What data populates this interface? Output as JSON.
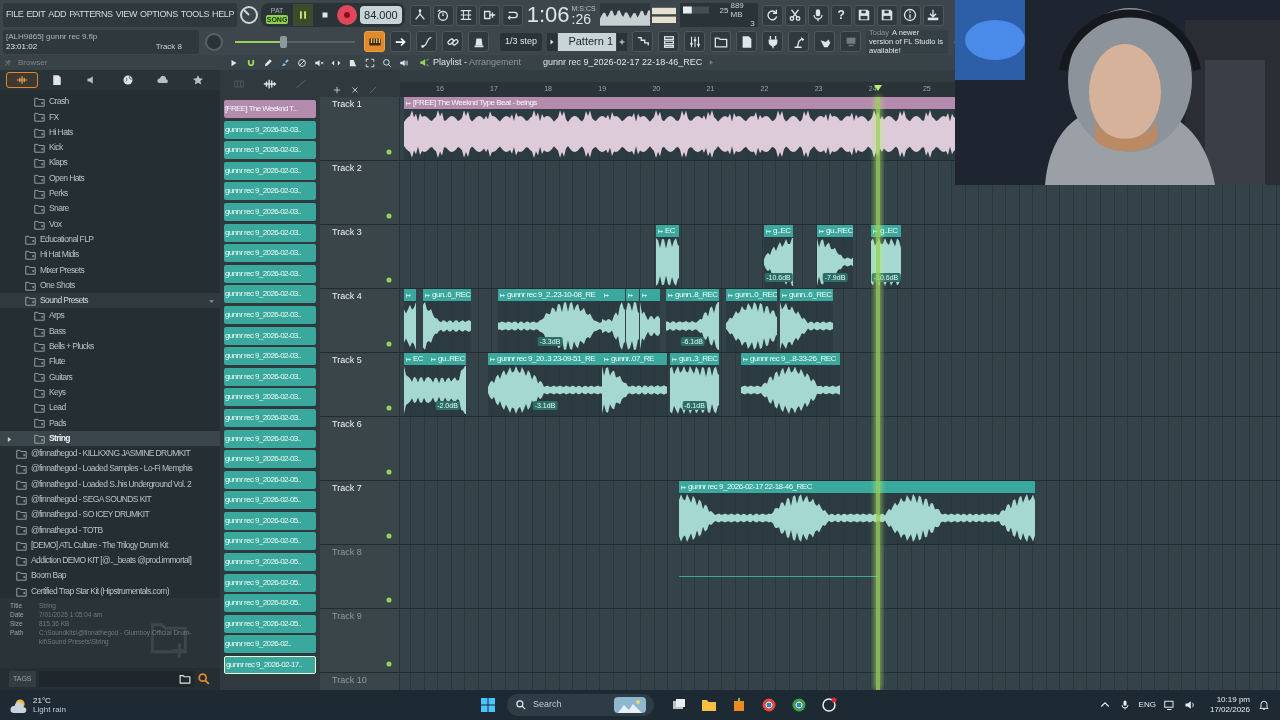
{
  "menu": [
    "FILE",
    "EDIT",
    "ADD",
    "PATTERNS",
    "VIEW",
    "OPTIONS",
    "TOOLS",
    "HELP"
  ],
  "transport": {
    "modes": [
      {
        "label": "PAT",
        "selected": false
      },
      {
        "label": "SONG",
        "selected": true
      }
    ],
    "tempo": "84.000"
  },
  "clock": {
    "value": "1:06",
    "centiseconds": ":26",
    "unit": "M:S:CS"
  },
  "monitor": {
    "cpu": "25",
    "memory": "889 MB",
    "polyphony": "3"
  },
  "help_button": "?",
  "project": {
    "file": "[ALH9865] gunnr rec 9.flp",
    "time": "23:01:02",
    "target": "Track 8"
  },
  "master_volume": {
    "level": 0.4
  },
  "snap": "1/3 step",
  "pattern": "Pattern 1",
  "news": {
    "when": "Today",
    "message": "A newer version of FL Studio is available!"
  },
  "browser": {
    "title": "Browser",
    "tabs": [
      {
        "selected": true
      },
      {
        "selected": false
      },
      {
        "selected": false
      },
      {
        "selected": false
      },
      {
        "selected": false
      },
      {
        "selected": false
      }
    ],
    "tree": [
      {
        "children": [
          {
            "children": [
              {
                "label": "Crash",
                "selected": false
              },
              {
                "label": "FX",
                "selected": false
              },
              {
                "label": "Hi Hats",
                "selected": false
              },
              {
                "label": "Kick",
                "selected": false
              },
              {
                "label": "Klaps",
                "selected": false
              },
              {
                "label": "Open Hats",
                "selected": false
              },
              {
                "label": "Perks",
                "selected": false
              },
              {
                "label": "Snare",
                "selected": false
              },
              {
                "label": "Vox",
                "selected": false
              }
            ]
          },
          {
            "label": "Educational FLP",
            "selected": false,
            "expanded": false
          },
          {
            "label": "Hi Hat Midis",
            "selected": false,
            "expanded": false
          },
          {
            "label": "Mixer Presets",
            "selected": false,
            "expanded": false
          },
          {
            "label": "One Shots",
            "selected": false,
            "expanded": false
          },
          {
            "label": "Sound Presets",
            "selected": false,
            "expanded": true,
            "children": [
              {
                "label": "Arps",
                "selected": false
              },
              {
                "label": "Bass",
                "selected": false
              },
              {
                "label": "Bells + Plucks",
                "selected": false
              },
              {
                "label": "Flute",
                "selected": false
              },
              {
                "label": "Guitars",
                "selected": false
              },
              {
                "label": "Keys",
                "selected": false
              },
              {
                "label": "Lead",
                "selected": false
              },
              {
                "label": "Pads",
                "selected": false
              },
              {
                "label": "String",
                "selected": true
              }
            ]
          }
        ]
      },
      {
        "label": "@finnathegod - KILLKXNG JASMINE DRUMKIT",
        "selected": false
      },
      {
        "label": "@finnathegod - Loaded Samples - Lo-Fi Memphis",
        "selected": false
      },
      {
        "label": "@finnathegod - Loaded S..his Underground Vol. 2",
        "selected": false
      },
      {
        "label": "@finnathegod - SEGA SOUNDS KIT",
        "selected": false
      },
      {
        "label": "@finnathegod - SO ICEY DRUMKIT",
        "selected": false
      },
      {
        "label": "@finnathegod - TOTB",
        "selected": false
      },
      {
        "label": "[DEMO] ATL Culture - The Trilogy Drum Kit",
        "selected": false
      },
      {
        "label": "Addiction DEMO KIT [@.._beats @prod.immortal]",
        "selected": false
      },
      {
        "label": "Boom Bap",
        "selected": false
      },
      {
        "label": "Certified Trap Star Kit (Hipstrumentals.com)",
        "selected": false
      }
    ],
    "info": [
      {
        "label": "Title",
        "value": "String"
      },
      {
        "label": "Date",
        "value": "7/01/2025 1:05:04 am"
      },
      {
        "label": "Size",
        "value": "815.36 KB"
      },
      {
        "label": "Path",
        "value": "C:\\Soundkits\\@finnathegod - Glumboy Official Drum-kit\\Sound Presets\\String"
      }
    ],
    "tags_button": "TAGS"
  },
  "playlist": {
    "title": "Playlist -",
    "mode": "Arrangement",
    "clip_name": "gunnr rec 9_2026-02-17 22-18-46_REC",
    "bars": [
      "16",
      "17",
      "18",
      "19",
      "20",
      "21",
      "22",
      "23",
      "24",
      "25"
    ],
    "clip_list": [
      {
        "label": "[FREE] The Weeknd T...",
        "color": "#b58bad",
        "selected": false
      },
      {
        "label": "gunnr rec 9_2026-02-03..",
        "color": "#3aa89c",
        "selected": false
      },
      {
        "label": "gunnr rec 9_2026-02-03..",
        "color": "#3aa89c",
        "selected": false
      },
      {
        "label": "gunnr rec 9_2026-02-03..",
        "color": "#3aa89c",
        "selected": false
      },
      {
        "label": "gunnr rec 9_2026-02-03..",
        "color": "#3aa89c",
        "selected": false
      },
      {
        "label": "gunnr rec 9_2026-02-03..",
        "color": "#3aa89c",
        "selected": false
      },
      {
        "label": "gunnr rec 9_2026-02-03..",
        "color": "#3aa89c",
        "selected": false
      },
      {
        "label": "gunnr rec 9_2026-02-03..",
        "color": "#3aa89c",
        "selected": false
      },
      {
        "label": "gunnr rec 9_2026-02-03..",
        "color": "#3aa89c",
        "selected": false
      },
      {
        "label": "gunnr rec 9_2026-02-03..",
        "color": "#3aa89c",
        "selected": false
      },
      {
        "label": "gunnr rec 9_2026-02-03..",
        "color": "#3aa89c",
        "selected": false
      },
      {
        "label": "gunnr rec 9_2026-02-03..",
        "color": "#3aa89c",
        "selected": false
      },
      {
        "label": "gunnr rec 9_2026-02-03..",
        "color": "#3aa89c",
        "selected": false
      },
      {
        "label": "gunnr rec 9_2026-02-03..",
        "color": "#3aa89c",
        "selected": false
      },
      {
        "label": "gunnr rec 9_2026-02-03..",
        "color": "#3aa89c",
        "selected": false
      },
      {
        "label": "gunnr rec 9_2026-02-03..",
        "color": "#3aa89c",
        "selected": false
      },
      {
        "label": "gunnr rec 9_2026-02-03..",
        "color": "#3aa89c",
        "selected": false
      },
      {
        "label": "gunnr rec 9_2026-02-03..",
        "color": "#3aa89c",
        "selected": false
      },
      {
        "label": "gunnr rec 9_2026-02-05..",
        "color": "#3aa89c",
        "selected": false
      },
      {
        "label": "gunnr rec 9_2026-02-05..",
        "color": "#3aa89c",
        "selected": false
      },
      {
        "label": "gunnr rec 9_2026-02-05..",
        "color": "#3aa89c",
        "selected": false
      },
      {
        "label": "gunnr rec 9_2026-02-05..",
        "color": "#3aa89c",
        "selected": false
      },
      {
        "label": "gunnr rec 9_2026-02-05..",
        "color": "#3aa89c",
        "selected": false
      },
      {
        "label": "gunnr rec 9_2026-02-05..",
        "color": "#3aa89c",
        "selected": false
      },
      {
        "label": "gunnr rec 9_2026-02-05..",
        "color": "#3aa89c",
        "selected": false
      },
      {
        "label": "gunnr rec 9_2026-02-05..",
        "color": "#3aa89c",
        "selected": false
      },
      {
        "label": "gunnr rec 9_2026-02..",
        "color": "#3aa89c",
        "selected": false
      },
      {
        "label": "gunnr rec 9_2026-02-17..",
        "color": "#3aa89c",
        "selected": true
      }
    ],
    "tracks": [
      {
        "name": "Track 1",
        "greyed": false,
        "clips": [
          {
            "kind": "audio",
            "label": "[FREE] The Weeknd Type Beat - beings",
            "color": "#b58bad"
          }
        ]
      },
      {
        "name": "Track 2",
        "greyed": false
      },
      {
        "name": "Track 3",
        "greyed": false,
        "clips": [
          {
            "kind": "audio",
            "label": "EC",
            "color": "#3aa89c"
          },
          {
            "kind": "audio",
            "label": "g..EC",
            "color": "#3aa89c",
            "gain": "-10.6dB"
          },
          {
            "kind": "audio",
            "label": "gu..REC",
            "color": "#3aa89c",
            "gain": "-7.9dB"
          },
          {
            "kind": "audio",
            "label": "g..EC",
            "color": "#3aa89c",
            "gain": "-10.6dB"
          }
        ]
      },
      {
        "name": "Track 4",
        "greyed": false,
        "clips": [
          {
            "kind": "audio",
            "color": "#3aa89c"
          },
          {
            "kind": "audio",
            "label": "gun..6_REC",
            "color": "#3aa89c"
          },
          {
            "kind": "audio",
            "label": "gunnr rec 9_2..23-10-08_RE",
            "color": "#3aa89c",
            "gain": "-3.3dB"
          },
          {
            "kind": "audio",
            "color": "#3aa89c"
          },
          {
            "kind": "audio",
            "color": "#3aa89c"
          },
          {
            "kind": "audio",
            "color": "#3aa89c"
          },
          {
            "kind": "audio",
            "label": "gunn..8_REC",
            "color": "#3aa89c",
            "gain": "-6.1dB"
          },
          {
            "kind": "audio",
            "label": "gunn..0_REC",
            "color": "#3aa89c"
          },
          {
            "kind": "audio",
            "label": "gunn..6_REC",
            "color": "#3aa89c"
          }
        ]
      },
      {
        "name": "Track 5",
        "greyed": false,
        "clips": [
          {
            "kind": "audio",
            "label": "EC",
            "color": "#3aa89c"
          },
          {
            "kind": "audio",
            "label": "gu..REC",
            "color": "#3aa89c",
            "gain": "-2.0dB"
          },
          {
            "kind": "audio",
            "label": "gunnr rec 9_20..3 23-09-51_RE",
            "color": "#3aa89c",
            "gain": "-3.1dB"
          },
          {
            "kind": "audio",
            "label": "gunnr..07_RE",
            "color": "#3aa89c"
          },
          {
            "kind": "audio",
            "label": "gun..3_REC",
            "color": "#3aa89c",
            "gain": "-6.1dB"
          },
          {
            "kind": "audio",
            "label": "gunnr rec 9_..8-33-26_REC",
            "color": "#3aa89c"
          }
        ]
      },
      {
        "name": "Track 6",
        "greyed": false
      },
      {
        "name": "Track 7",
        "greyed": false,
        "clips": [
          {
            "kind": "audio",
            "label": "gunnr rec 9_2026-02-17 22-18-46_REC",
            "color": "#3aa89c"
          }
        ]
      },
      {
        "name": "Track 8",
        "greyed": true,
        "clips": [
          {
            "kind": "recording",
            "color": "#3aa89c"
          }
        ]
      },
      {
        "name": "Track 9",
        "greyed": true
      },
      {
        "name": "Track 10",
        "greyed": true
      }
    ]
  },
  "taskbar": {
    "temperature": "21°C",
    "weather": "Light rain",
    "search": "Search",
    "language": "ENG",
    "time": "10:19 pm",
    "date": "17/02/2026"
  },
  "webcam": {
    "kind": "picture"
  }
}
